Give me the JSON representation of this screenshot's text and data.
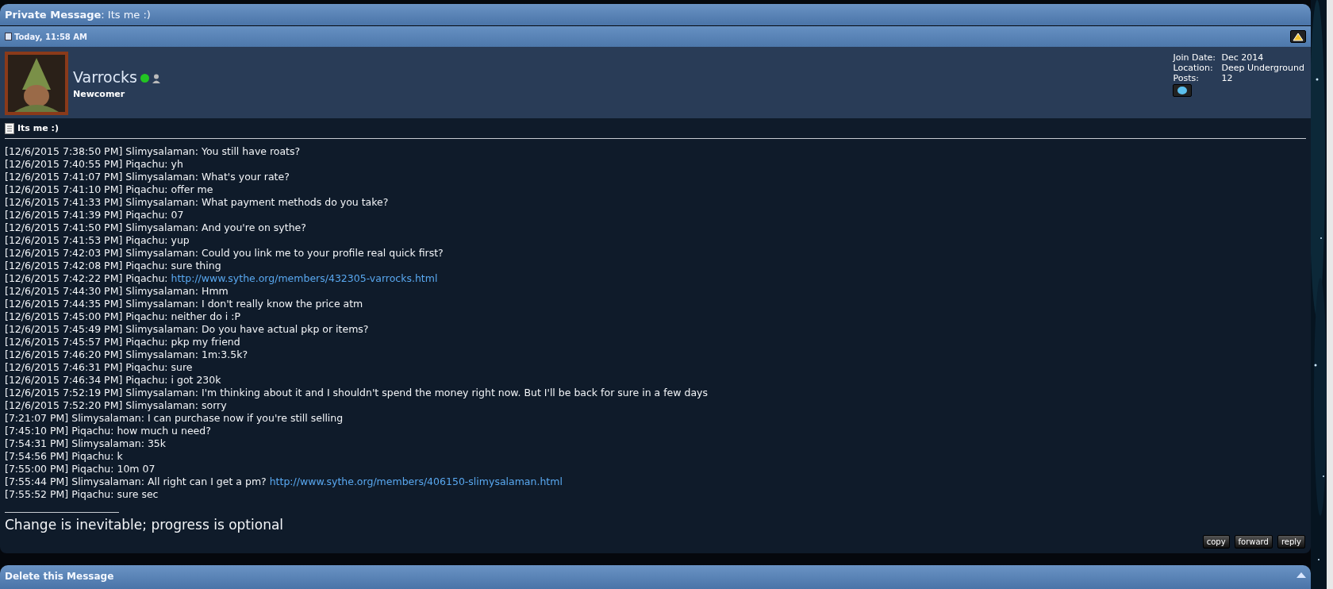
{
  "header": {
    "title_label": "Private Message",
    "title": ": Its me :)"
  },
  "date_bar": {
    "date": "Today, 11:58 AM"
  },
  "user": {
    "name": "Varrocks",
    "online": true,
    "rank": "Newcomer",
    "details": [
      {
        "label": "Join Date:",
        "value": "Dec 2014"
      },
      {
        "label": "Location:",
        "value": "Deep Underground"
      },
      {
        "label": "Posts:",
        "value": "12"
      }
    ]
  },
  "message": {
    "title": "Its me :)",
    "lines": [
      {
        "text": "[12/6/2015 7:38:50 PM] Slimysalaman: You still have roats?"
      },
      {
        "text": "[12/6/2015 7:40:55 PM] Piqachu: yh"
      },
      {
        "text": "[12/6/2015 7:41:07 PM] Slimysalaman: What's your rate?"
      },
      {
        "text": "[12/6/2015 7:41:10 PM] Piqachu: offer me"
      },
      {
        "text": "[12/6/2015 7:41:33 PM] Slimysalaman: What payment methods do you take?"
      },
      {
        "text": "[12/6/2015 7:41:39 PM] Piqachu: 07"
      },
      {
        "text": "[12/6/2015 7:41:50 PM] Slimysalaman: And you're on sythe?"
      },
      {
        "text": "[12/6/2015 7:41:53 PM] Piqachu: yup"
      },
      {
        "text": "[12/6/2015 7:42:03 PM] Slimysalaman: Could you link me to your profile real quick first?"
      },
      {
        "text": "[12/6/2015 7:42:08 PM] Piqachu: sure thing"
      },
      {
        "text": "[12/6/2015 7:42:22 PM] Piqachu:",
        "link": "http://www.sythe.org/members/432305-varrocks.html"
      },
      {
        "text": "[12/6/2015 7:44:30 PM] Slimysalaman: Hmm"
      },
      {
        "text": "[12/6/2015 7:44:35 PM] Slimysalaman: I don't really know the price atm"
      },
      {
        "text": "[12/6/2015 7:45:00 PM] Piqachu: neither do i :P"
      },
      {
        "text": "[12/6/2015 7:45:49 PM] Slimysalaman: Do you have actual pkp or items?"
      },
      {
        "text": "[12/6/2015 7:45:57 PM] Piqachu: pkp my friend"
      },
      {
        "text": "[12/6/2015 7:46:20 PM] Slimysalaman: 1m:3.5k?"
      },
      {
        "text": "[12/6/2015 7:46:31 PM] Piqachu: sure"
      },
      {
        "text": "[12/6/2015 7:46:34 PM] Piqachu: i got 230k"
      },
      {
        "text": "[12/6/2015 7:52:19 PM] Slimysalaman: I'm thinking about it and I shouldn't spend the money right now. But I'll be back for sure in a few days"
      },
      {
        "text": "[12/6/2015 7:52:20 PM] Slimysalaman: sorry"
      },
      {
        "text": "[7:21:07 PM] Slimysalaman: I can purchase now if you're still selling"
      },
      {
        "text": "[7:45:10 PM] Piqachu: how much u need?"
      },
      {
        "text": "[7:54:31 PM] Slimysalaman: 35k"
      },
      {
        "text": "[7:54:56 PM] Piqachu: k"
      },
      {
        "text": "[7:55:00 PM] Piqachu: 10m 07"
      },
      {
        "text": "[7:55:44 PM] Slimysalaman: All right can I get a pm?",
        "link": "http://www.sythe.org/members/406150-slimysalaman.html"
      },
      {
        "text": "[7:55:52 PM] Piqachu: sure sec"
      }
    ],
    "signature": "Change is inevitable; progress is optional",
    "buttons": [
      "copy",
      "forward",
      "reply"
    ]
  },
  "next_section": {
    "title": "Delete this Message"
  }
}
